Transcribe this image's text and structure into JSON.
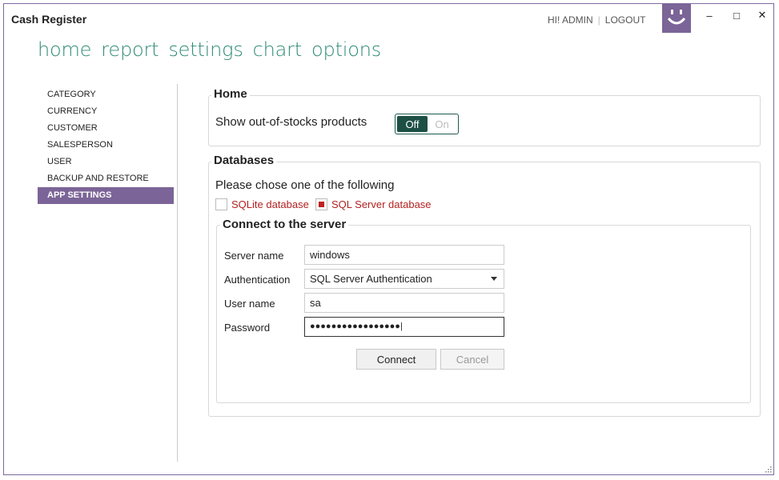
{
  "app": {
    "title": "Cash Register"
  },
  "user": {
    "greeting": "HI! ADMIN",
    "separator": "|",
    "logout": "LOGOUT"
  },
  "window_controls": {
    "minimize": "–",
    "maximize": "□",
    "close": "✕"
  },
  "topnav": [
    "home",
    "report",
    "settings",
    "chart",
    "options"
  ],
  "sidebar": {
    "items": [
      {
        "label": "CATEGORY"
      },
      {
        "label": "CURRENCY"
      },
      {
        "label": "CUSTOMER"
      },
      {
        "label": "SALESPERSON"
      },
      {
        "label": "USER"
      },
      {
        "label": "BACKUP AND RESTORE"
      },
      {
        "label": "APP SETTINGS",
        "active": true
      }
    ]
  },
  "home_group": {
    "title": "Home",
    "option_label": "Show out-of-stocks products",
    "toggle": {
      "off": "Off",
      "on": "On",
      "state": "Off"
    }
  },
  "db_group": {
    "title": "Databases",
    "prompt": "Please chose one of the following",
    "options": [
      {
        "label": "SQLite database",
        "checked": false
      },
      {
        "label": "SQL Server database",
        "checked": true
      }
    ]
  },
  "server_group": {
    "title": "Connect to the server",
    "server_name": {
      "label": "Server name",
      "value": "windows"
    },
    "authentication": {
      "label": "Authentication",
      "value": "SQL Server Authentication"
    },
    "user_name": {
      "label": "User name",
      "value": "sa"
    },
    "password": {
      "label": "Password",
      "value": "●●●●●●●●●●●●●●●●●|"
    },
    "connect": "Connect",
    "cancel": "Cancel"
  },
  "colors": {
    "accent": "#7b6497",
    "nav": "#2e8b74",
    "toggle": "#1d4f45",
    "check": "#b22222"
  },
  "icons": {
    "avatar": "smiley-icon",
    "grip": "resize-grip-icon",
    "dropdown": "chevron-down-icon"
  }
}
